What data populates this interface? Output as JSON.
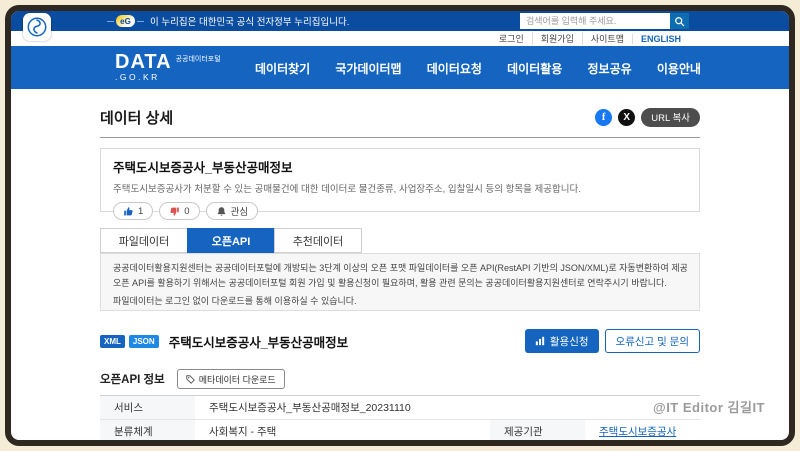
{
  "gov_banner": {
    "egov_mark": "eG",
    "text": "이 누리집은 대한민국 공식 전자정부 누리집입니다.",
    "search_placeholder": "검색어를 입력해 주세요."
  },
  "util": {
    "links": [
      "로그인",
      "회원가입",
      "사이트맵",
      "ENGLISH"
    ]
  },
  "header": {
    "logo": {
      "main": "DATA",
      "caption": "공공데이터포털",
      "sub": ".GO.KR"
    },
    "nav": [
      "데이터찾기",
      "국가데이터맵",
      "데이터요청",
      "데이터활용",
      "정보공유",
      "이용안내"
    ]
  },
  "page": {
    "title": "데이터 상세",
    "share": {
      "facebook_glyph": "f",
      "x_glyph": "X",
      "url_copy": "URL 복사"
    }
  },
  "dataset": {
    "title": "주택도시보증공사_부동산공매정보",
    "description": "주택도시보증공사가 처분할 수 있는 공매물건에 대한 데이터로 물건종류, 사업장주소, 입찰일시 등의 항목을 제공합니다.",
    "like_count": "1",
    "dislike_count": "0",
    "interest_label": "관심"
  },
  "tabs": {
    "items": [
      "파일데이터",
      "오픈API",
      "추천데이터"
    ],
    "active": "오픈API"
  },
  "notice": {
    "line1": "공공데이터활용지원센터는 공공데이터포털에 개방되는 3단계 이상의 오픈 포맷 파일데이터를 오픈 API(RestAPI 기반의 JSON/XML)로 자동변환하여 제공합니다.",
    "line2": "오픈 API를 활용하기 위해서는 공공데이터포털 회원 가입 및 활용신청이 필요하며, 활용 관련 문의는 공공데이터활용지원센터로 연락주시기 바랍니다.",
    "line3": "파일데이터는 로그인 없이 다운로드를 통해 이용하실 수 있습니다."
  },
  "api_bar": {
    "formats": [
      "XML",
      "JSON"
    ],
    "title": "주택도시보증공사_부동산공매정보",
    "apply_label": "활용신청",
    "report_label": "오류신고 및 문의"
  },
  "api_info": {
    "section_label": "오픈API 정보",
    "meta_button": "메타데이터 다운로드",
    "table": {
      "row1": {
        "label": "서비스",
        "value": "주택도시보증공사_부동산공매정보_20231110"
      },
      "row2": {
        "label": "분류체계",
        "value": "사회복지 - 주택",
        "label2": "제공기관",
        "link": "주택도시보증공사"
      }
    }
  },
  "watermark": "@IT Editor 김길IT",
  "colors": {
    "banner_blue": "#0a4c9f",
    "primary_blue": "#1565c0",
    "like_blue": "#1565c0",
    "dislike_red": "#d9534f",
    "frame_brown": "#2e2820"
  }
}
